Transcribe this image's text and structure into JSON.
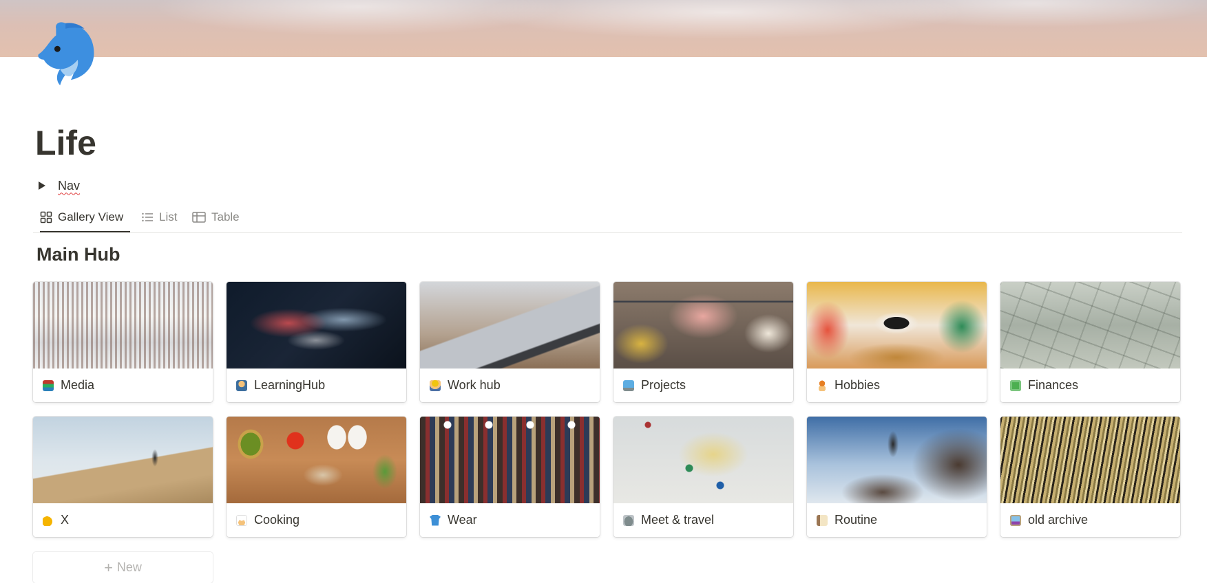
{
  "page": {
    "title": "Life",
    "cover": "beach-shoreline-cover",
    "icon": "dolphin-icon"
  },
  "toggle": {
    "label": "Nav",
    "icon": "triangle-right-icon"
  },
  "views": {
    "tabs": [
      {
        "label": "Gallery View",
        "icon": "gallery-grid-icon",
        "active": true
      },
      {
        "label": "List",
        "icon": "list-icon",
        "active": false
      },
      {
        "label": "Table",
        "icon": "table-icon",
        "active": false
      }
    ]
  },
  "gallery": {
    "title": "Main Hub",
    "cards": [
      {
        "label": "Media",
        "emoji": "books-emoji",
        "cover": "library-interior",
        "accent": "#c0392b"
      },
      {
        "label": "LearningHub",
        "emoji": "student-emoji",
        "cover": "light-trails",
        "accent": "#e6a23c"
      },
      {
        "label": "Work hub",
        "emoji": "worker-emoji",
        "cover": "laptop-meeting",
        "accent": "#f1c40f"
      },
      {
        "label": "Projects",
        "emoji": "laptop-emoji",
        "cover": "team-laptop",
        "accent": "#2980b9"
      },
      {
        "label": "Hobbies",
        "emoji": "juggler-emoji",
        "cover": "eye-artwork",
        "accent": "#e67e22"
      },
      {
        "label": "Finances",
        "emoji": "dollar-banknote-emoji",
        "cover": "dollar-bills",
        "accent": "#4caf50"
      },
      {
        "label": "X",
        "emoji": "flexed-biceps-emoji",
        "cover": "hill-runner",
        "accent": "#f5b400"
      },
      {
        "label": "Cooking",
        "emoji": "cook-emoji",
        "cover": "vegetables-board",
        "accent": "#8e6e53"
      },
      {
        "label": "Wear",
        "emoji": "tshirt-emoji",
        "cover": "clothing-store",
        "accent": "#3d8fd6"
      },
      {
        "label": "Meet & travel",
        "emoji": "stadium-emoji",
        "cover": "map-pins",
        "accent": "#7f8c8d"
      },
      {
        "label": "Routine",
        "emoji": "notebook-emoji",
        "cover": "mountain-climber",
        "accent": "#9b7653"
      },
      {
        "label": "old archive",
        "emoji": "frame-emoji",
        "cover": "record-crates",
        "accent": "#8e44ad"
      }
    ],
    "new_label": "New"
  }
}
